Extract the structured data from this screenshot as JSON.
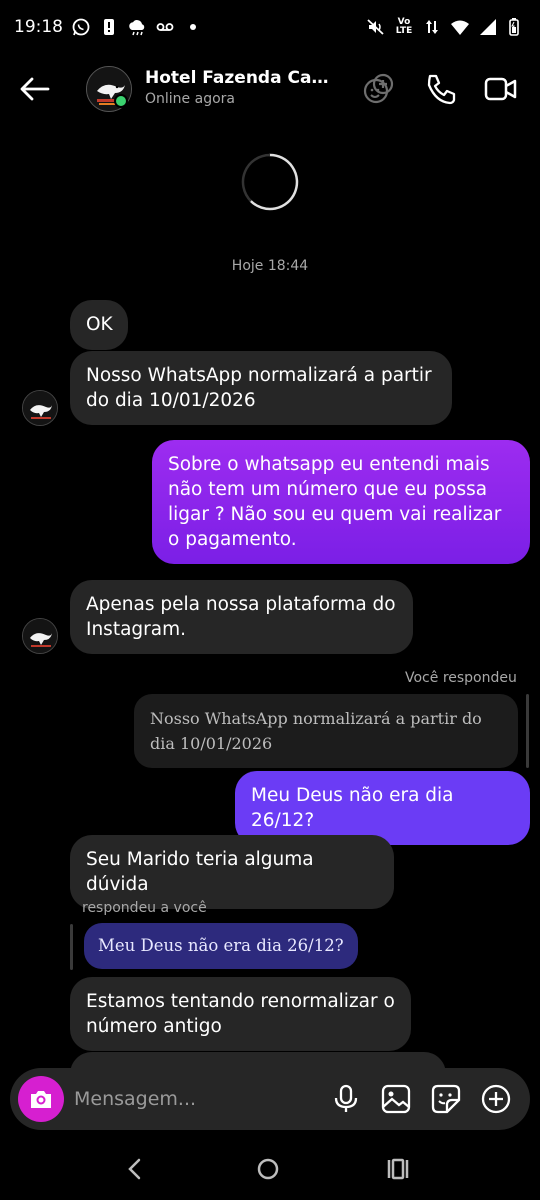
{
  "status_bar": {
    "time": "19:18",
    "left_icons": [
      "whatsapp-icon",
      "alert-icon",
      "weather-icon",
      "voicemail-icon",
      "dot-icon"
    ],
    "right_icons": [
      "mute-icon",
      "volte-icon",
      "data-arrows-icon",
      "wifi-icon",
      "signal-icon",
      "battery-icon"
    ],
    "volte_top": "Vo",
    "volte_bottom": "LTE"
  },
  "header": {
    "name": "Hotel Fazenda Canár…",
    "status": "Online agora",
    "icons": [
      "back-arrow-icon",
      "effects-icon",
      "phone-icon",
      "video-call-icon"
    ]
  },
  "conversation": {
    "timestamp": "Hoje 18:44",
    "messages": [
      {
        "side": "in",
        "text": "OK"
      },
      {
        "side": "in",
        "text": "Nosso WhatsApp normalizará a partir do dia 10/01/2026"
      },
      {
        "side": "out",
        "text": "Sobre o whatsapp eu entendi mais não tem um número que eu possa ligar ? Não sou eu quem vai realizar o pagamento."
      },
      {
        "side": "in",
        "text": "Apenas pela nossa plataforma do Instagram."
      },
      {
        "side": "out",
        "reply_label": "Você respondeu",
        "quoted": "Nosso WhatsApp normalizará a partir do dia 10/01/2026",
        "text": "Meu Deus não era dia 26/12?"
      },
      {
        "side": "in",
        "text": "Seu Marido teria alguma dúvida"
      },
      {
        "side": "in",
        "reply_label": "respondeu a você",
        "quoted": "Meu Deus não era dia 26/12?",
        "text": "Estamos tentando renormalizar o número antigo"
      }
    ]
  },
  "composer": {
    "placeholder": "Mensagem...",
    "icons": [
      "camera-icon",
      "microphone-icon",
      "gallery-icon",
      "sticker-icon",
      "plus-icon"
    ]
  },
  "nav": {
    "icons": [
      "nav-back-icon",
      "nav-home-icon",
      "nav-recents-icon"
    ]
  },
  "colors": {
    "background": "#000000",
    "incoming_bubble": "#262626",
    "outgoing_bubble": "#8e25ec",
    "outgoing_bubble_blue": "#6b3cf5",
    "online": "#3bd16f",
    "camera": "#d61fd0"
  }
}
